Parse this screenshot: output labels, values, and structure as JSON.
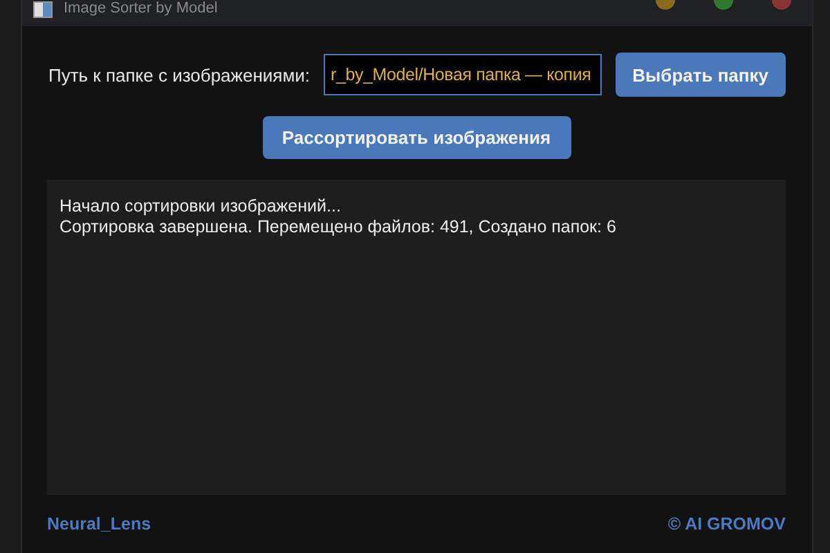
{
  "window": {
    "title": "Image Sorter by Model"
  },
  "path_label": "Путь к папке с изображениями:",
  "path_field": {
    "value": "r_by_Model/Новая папка — копия"
  },
  "browse_button": "Выбрать папку",
  "sort_button": "Рассортировать изображения",
  "log": [
    "Начало сортировки изображений...",
    "Сортировка завершена. Перемещено файлов: 491, Создано папок: 6"
  ],
  "footer": {
    "left": "Neural_Lens",
    "right": "© AI GROMOV"
  }
}
